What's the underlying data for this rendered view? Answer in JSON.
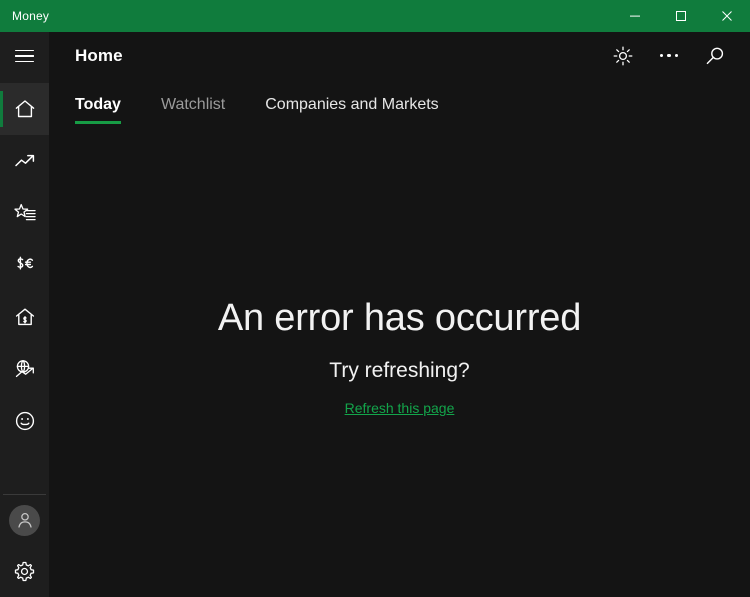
{
  "window": {
    "title": "Money",
    "accent_green": "#107C3D",
    "controls": [
      {
        "name": "minimize",
        "label": "Minimize"
      },
      {
        "name": "maximize",
        "label": "Maximize"
      },
      {
        "name": "close",
        "label": "Close"
      }
    ]
  },
  "sidebar": {
    "menu_button": {
      "icon": "hamburger-icon",
      "label": "Navigation"
    },
    "items": [
      {
        "icon": "home-icon",
        "label": "Home",
        "active": true
      },
      {
        "icon": "trending-up-icon",
        "label": "Markets",
        "active": false
      },
      {
        "icon": "watchlist-star-icon",
        "label": "Watchlist",
        "active": false
      },
      {
        "icon": "currency-icon",
        "label": "Currencies",
        "active": false
      },
      {
        "icon": "mortgage-house-icon",
        "label": "Mortgage Calculator",
        "active": false
      },
      {
        "icon": "world-markets-icon",
        "label": "World Markets",
        "active": false
      },
      {
        "icon": "feedback-smiley-icon",
        "label": "Feedback",
        "active": false
      }
    ],
    "account": {
      "icon": "avatar-icon",
      "label": "Account"
    },
    "settings": {
      "icon": "gear-icon",
      "label": "Settings"
    }
  },
  "header": {
    "title": "Home",
    "actions": [
      {
        "icon": "brightness-sun-icon",
        "label": "Change theme"
      },
      {
        "icon": "more-dots-icon",
        "label": "See more"
      },
      {
        "icon": "search-icon",
        "label": "Search"
      }
    ]
  },
  "tabs": {
    "active_index": 0,
    "items": [
      {
        "label": "Today"
      },
      {
        "label": "Watchlist"
      },
      {
        "label": "Companies and Markets"
      }
    ]
  },
  "error": {
    "title": "An error has occurred",
    "subtitle": "Try refreshing?",
    "link_label": "Refresh this page",
    "link_color": "#13A54B"
  }
}
